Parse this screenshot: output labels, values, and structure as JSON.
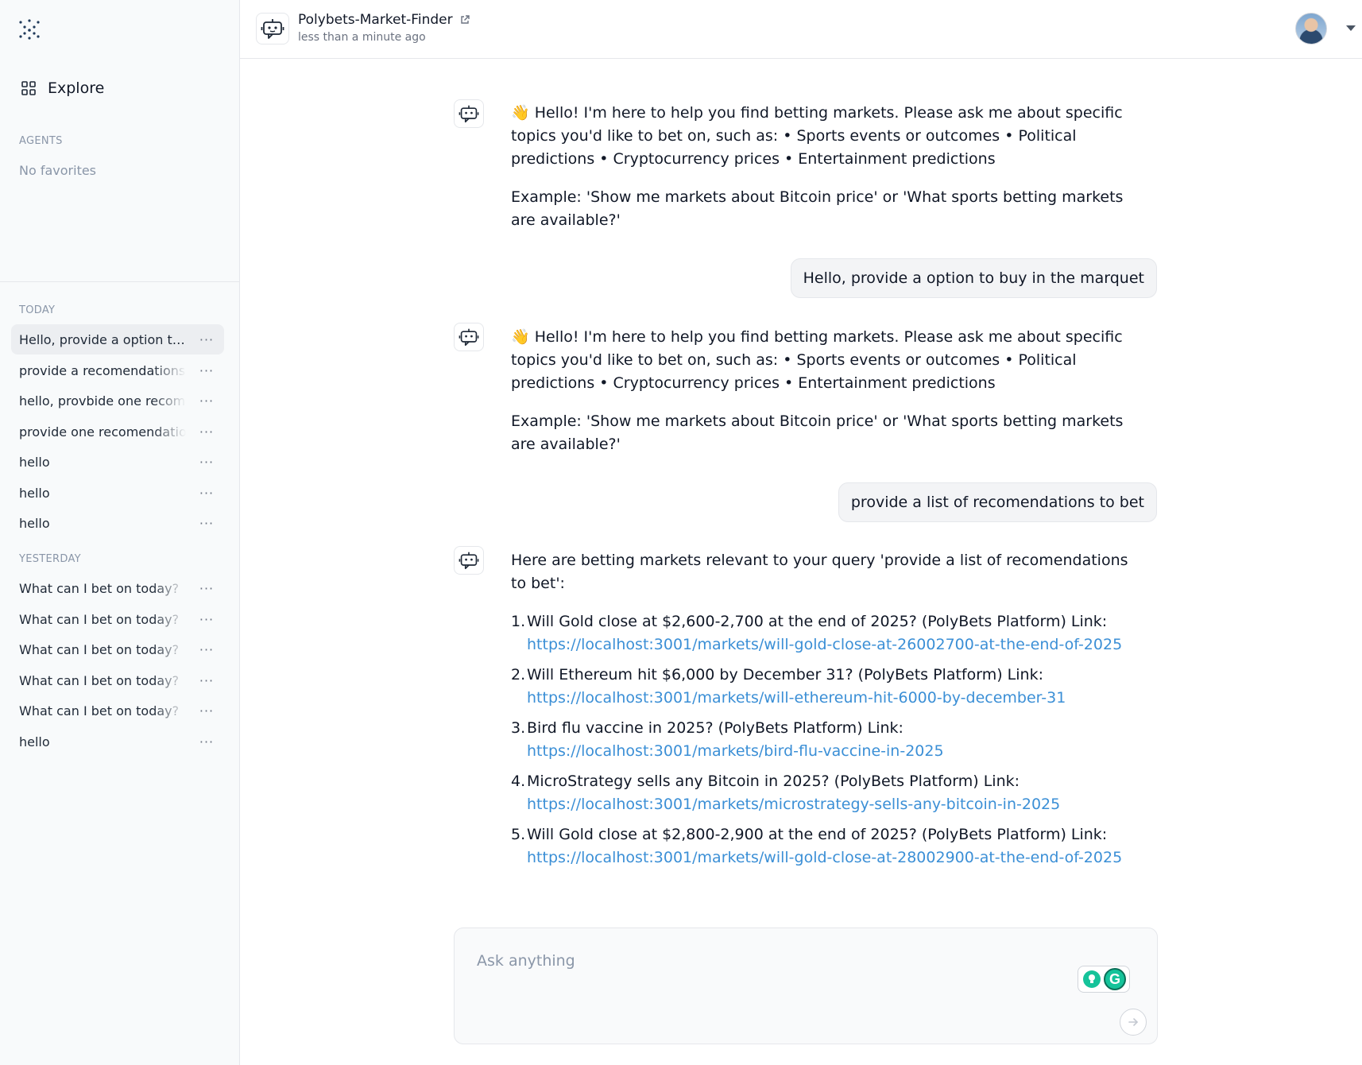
{
  "sidebar": {
    "explore_label": "Explore",
    "agents_label": "AGENTS",
    "no_favorites": "No favorites",
    "today_label": "TODAY",
    "yesterday_label": "YESTERDAY",
    "today": [
      {
        "label": "Hello, provide a option to buy in the marquet"
      },
      {
        "label": "provide a recomendations"
      },
      {
        "label": "hello, provbide one recomendation"
      },
      {
        "label": "provide one recomendation"
      },
      {
        "label": "hello"
      },
      {
        "label": "hello"
      },
      {
        "label": "hello"
      }
    ],
    "yesterday": [
      {
        "label": "What can I bet on today?"
      },
      {
        "label": "What can I bet on today?"
      },
      {
        "label": "What can I bet on today?"
      },
      {
        "label": "What can I bet on today?"
      },
      {
        "label": "What can I bet on today?"
      },
      {
        "label": "hello"
      }
    ],
    "more_glyph": "···"
  },
  "header": {
    "agent_name": "Polybets-Market-Finder",
    "time": "less than a minute ago"
  },
  "chat": {
    "greeting": {
      "p1": "👋 Hello! I'm here to help you find betting markets. Please ask me about specific topics you'd like to bet on, such as: • Sports events or outcomes • Political predictions • Cryptocurrency prices • Entertainment predictions",
      "p2": "Example: 'Show me markets about Bitcoin price' or 'What sports betting markets are available?'"
    },
    "user1": "Hello, provide a option to buy in the marquet",
    "greeting2": {
      "p1": "👋 Hello! I'm here to help you find betting markets. Please ask me about specific topics you'd like to bet on, such as: • Sports events or outcomes • Political predictions • Cryptocurrency prices • Entertainment predictions",
      "p2": "Example: 'Show me markets about Bitcoin price' or 'What sports betting markets are available?'"
    },
    "user2": "provide a list of recomendations to bet",
    "results_intro": "Here are betting markets relevant to your query 'provide a list of recomendations to bet':",
    "results": [
      {
        "num": "1.",
        "text": "Will Gold close at $2,600-2,700 at the end of 2025? (PolyBets Platform) Link:",
        "link": "https://localhost:3001/markets/will-gold-close-at-26002700-at-the-end-of-2025"
      },
      {
        "num": "2.",
        "text": "Will Ethereum hit $6,000 by December 31? (PolyBets Platform) Link:",
        "link": "https://localhost:3001/markets/will-ethereum-hit-6000-by-december-31"
      },
      {
        "num": "3.",
        "text": "Bird flu vaccine in 2025? (PolyBets Platform) Link:",
        "link": "https://localhost:3001/markets/bird-flu-vaccine-in-2025"
      },
      {
        "num": "4.",
        "text": "MicroStrategy sells any Bitcoin in 2025? (PolyBets Platform) Link:",
        "link": "https://localhost:3001/markets/microstrategy-sells-any-bitcoin-in-2025"
      },
      {
        "num": "5.",
        "text": "Will Gold close at $2,800-2,900 at the end of 2025? (PolyBets Platform) Link:",
        "link": "https://localhost:3001/markets/will-gold-close-at-28002900-at-the-end-of-2025"
      }
    ]
  },
  "composer": {
    "placeholder": "Ask anything",
    "value": "",
    "grammarly_letter": "G"
  },
  "colors": {
    "link": "#3b8fd6",
    "sidebar_bg": "#f8fafb",
    "muted": "#8a96a8",
    "grammarly": "#15c39a"
  }
}
